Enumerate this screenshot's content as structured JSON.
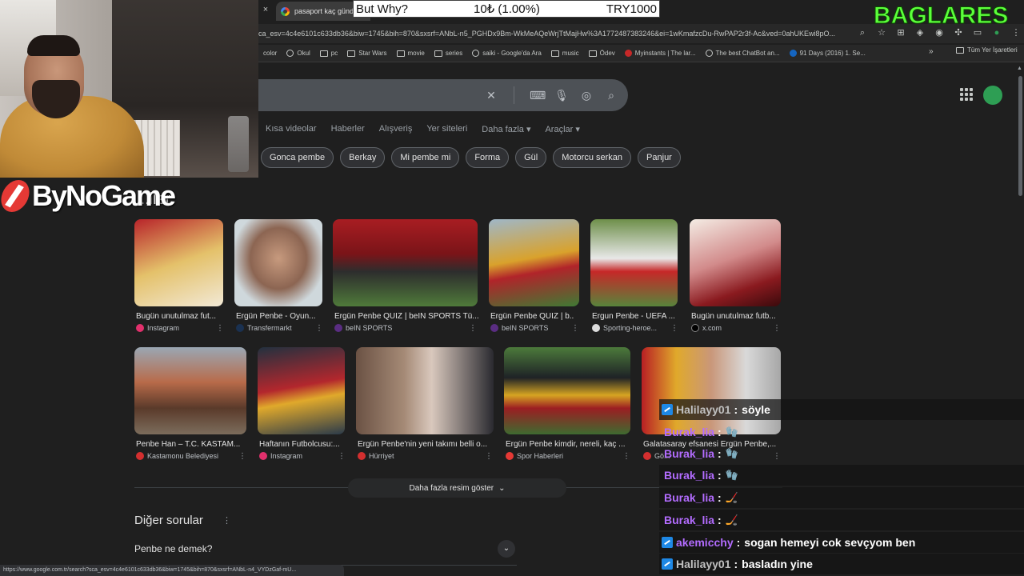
{
  "browser": {
    "tab_title": "pasaport kaç günde",
    "tab_close": "×",
    "url": "ca_esv=4c4e6101c633db36&biw=1745&bih=870&sxsrf=ANbL-n5_PGHDx9Bm-WkMeAQeWrjTtMajHw%3A1772487383246&ei=1wKmafzcDu-RwPAP2r3f-Ac&ved=0ahUKEwi8pO...",
    "bookmarks": [
      "color",
      "Okul",
      "pc",
      "Star Wars",
      "movie",
      "series",
      "saiki - Google'da Ara",
      "music",
      "Ödev",
      "Myinstants | The lar...",
      "The best ChatBot an...",
      "91 Days (2016) 1. Se..."
    ],
    "bookmarks_more": "»",
    "all_bookmarks": "Tüm Yer İşaretleri",
    "status_url": "https://www.google.com.tr/search?sca_esv=4c4e6101c633db36&biw=1745&bih=870&sxsrf=ANbL-n4_VYDzGaf-mU..."
  },
  "google": {
    "nav_tabs": [
      "Kısa videolar",
      "Haberler",
      "Alışveriş",
      "Yer siteleri",
      "Daha fazla ▾",
      "Araçlar ▾"
    ],
    "chips": [
      "Gonca pembe",
      "Berkay",
      "Mi pembe mi",
      "Forma",
      "Gül",
      "Motorcu serkan",
      "Panjur"
    ],
    "section_title": "...ller",
    "images_row1": [
      {
        "caption": "Bugün unutulmaz fut...",
        "source": "Instagram",
        "src_color": "#e1306c"
      },
      {
        "caption": "Ergün Penbe - Oyun...",
        "source": "Transfermarkt",
        "src_color": "#1a3151"
      },
      {
        "caption": "Ergün Penbe QUIZ | beIN SPORTS Tü...",
        "source": "beIN SPORTS",
        "src_color": "#5a2d82"
      },
      {
        "caption": "Ergün Penbe QUIZ | b...",
        "source": "beIN SPORTS",
        "src_color": "#5a2d82"
      },
      {
        "caption": "Ergun Penbe - UEFA ...",
        "source": "Sporting-heroe...",
        "src_color": "#dddddd"
      },
      {
        "caption": "Bugün unutulmaz futb...",
        "source": "x.com",
        "src_color": "#000000"
      }
    ],
    "images_row2": [
      {
        "caption": "Penbe Han – T.C. KASTAM...",
        "source": "Kastamonu Belediyesi",
        "src_color": "#d32f2f"
      },
      {
        "caption": "Haftanın Futbolcusu:...",
        "source": "Instagram",
        "src_color": "#e1306c"
      },
      {
        "caption": "Ergün Penbe'nin yeni takımı belli o...",
        "source": "Hürriyet",
        "src_color": "#d32f2f"
      },
      {
        "caption": "Ergün Penbe kimdir, nereli, kaç ...",
        "source": "Spor Haberleri",
        "src_color": "#e53935"
      },
      {
        "caption": "Galatasaray efsanesi Ergün Penbe,...",
        "source": "Gö...",
        "src_color": "#d32f2f"
      }
    ],
    "more_images": "Daha fazla resim göster",
    "other_questions": "Diğer sorular",
    "question_1": "Penbe ne demek?"
  },
  "overlay": {
    "logo_text": "ByNoGame",
    "brand_text": "BAGLARES",
    "alert_question": "But Why?",
    "alert_amount": "10₺ (1.00%)",
    "alert_goal": "TRY1000"
  },
  "chat": [
    {
      "user": "Halilayy01",
      "color": "#c0c0c0",
      "msg": "söyle",
      "emote": "",
      "badge": true,
      "shade": true
    },
    {
      "user": "Burak_lia",
      "color": "#b36cff",
      "msg": "",
      "emote": "🧤",
      "badge": false,
      "shade": false
    },
    {
      "user": "Burak_lia",
      "color": "#b36cff",
      "msg": "",
      "emote": "🧤",
      "badge": false,
      "shade": false
    },
    {
      "user": "Burak_lia",
      "color": "#b36cff",
      "msg": "",
      "emote": "🧤",
      "badge": false,
      "shade": true
    },
    {
      "user": "Burak_lia",
      "color": "#b36cff",
      "msg": "",
      "emote": "🏒",
      "badge": false,
      "shade": true
    },
    {
      "user": "Burak_lia",
      "color": "#b36cff",
      "msg": "",
      "emote": "🏒",
      "badge": false,
      "shade": true
    },
    {
      "user": "akemicchy",
      "color": "#b36cff",
      "msg": "sogan hemeyi cok sevçyom ben",
      "emote": "",
      "badge": true,
      "shade": true
    },
    {
      "user": "Halilayy01",
      "color": "#c0c0c0",
      "msg": "basladın yine",
      "emote": "",
      "badge": true,
      "shade": true
    }
  ]
}
